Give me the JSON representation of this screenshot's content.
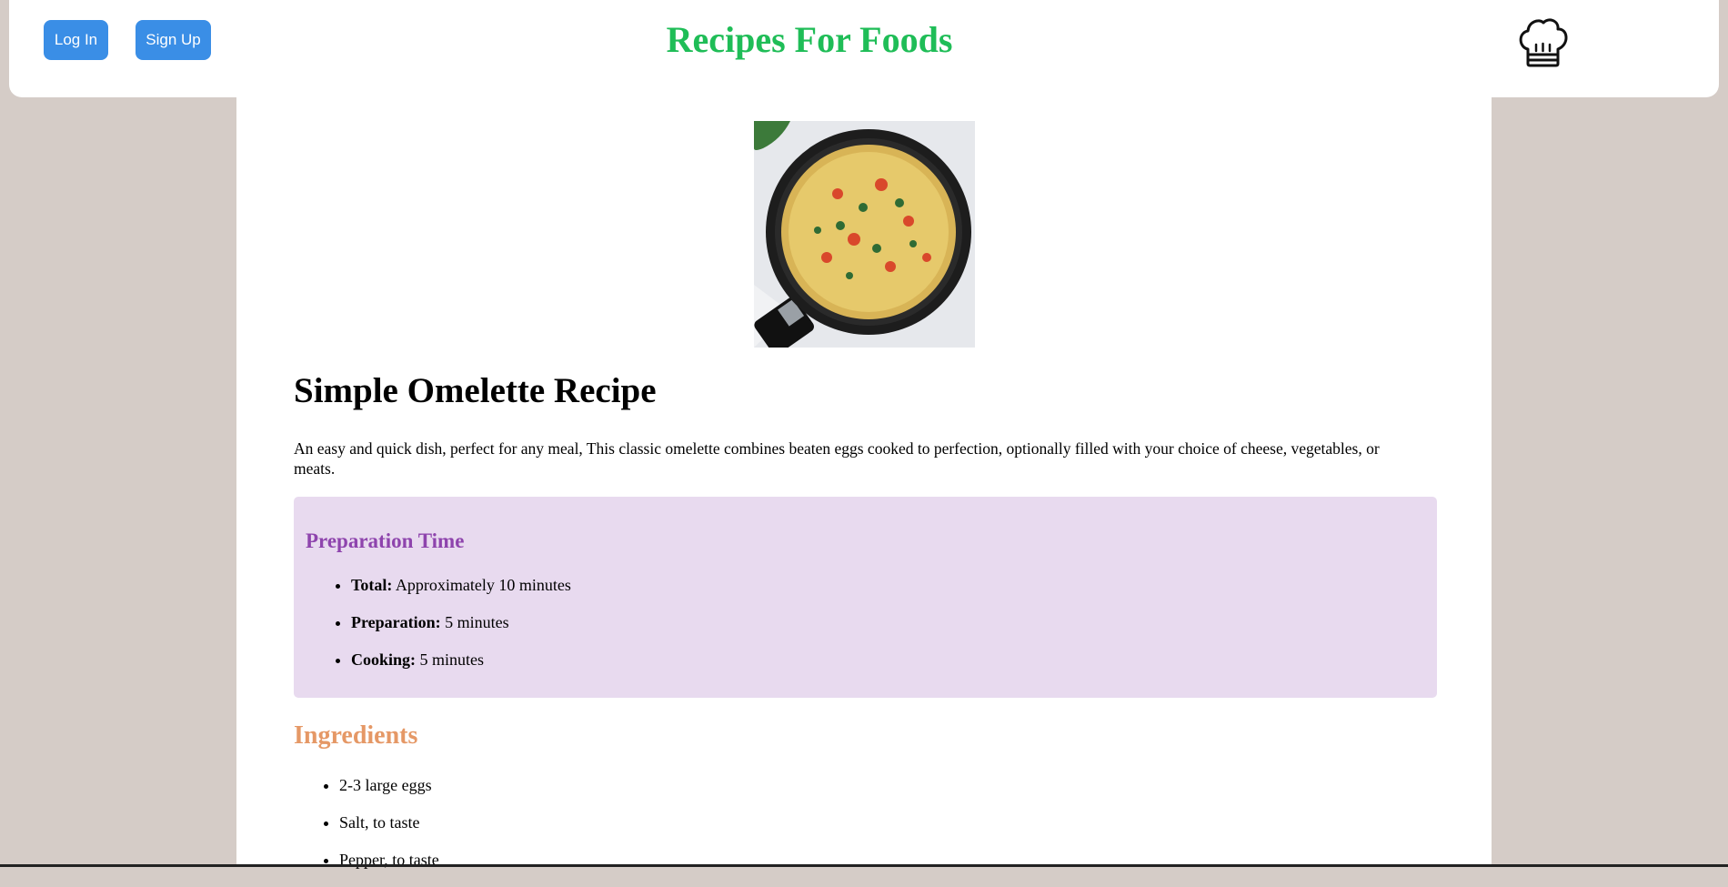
{
  "header": {
    "login_label": "Log In",
    "signup_label": "Sign Up",
    "site_title": "Recipes For Foods",
    "logo_icon": "chef-hat-icon"
  },
  "recipe": {
    "image_alt": "omelette-in-pan",
    "title": "Simple Omelette Recipe",
    "description": "An easy and quick dish, perfect for any meal, This classic omelette combines beaten eggs cooked to perfection, optionally filled with your choice of cheese, vegetables, or meats."
  },
  "prep": {
    "heading": "Preparation Time",
    "items": [
      {
        "label": "Total:",
        "value": " Approximately 10 minutes"
      },
      {
        "label": "Preparation:",
        "value": " 5 minutes"
      },
      {
        "label": "Cooking:",
        "value": " 5 minutes"
      }
    ]
  },
  "ingredients": {
    "heading": "Ingredients",
    "items": [
      "2-3 large eggs",
      "Salt, to taste",
      "Pepper, to taste"
    ]
  },
  "colors": {
    "title_green": "#1fbd57",
    "button_blue": "#3a8ee6",
    "prep_bg": "#e8daef",
    "prep_heading": "#8e44ad",
    "ingredients_heading": "#e59866",
    "page_bg": "#d5ccc7"
  }
}
